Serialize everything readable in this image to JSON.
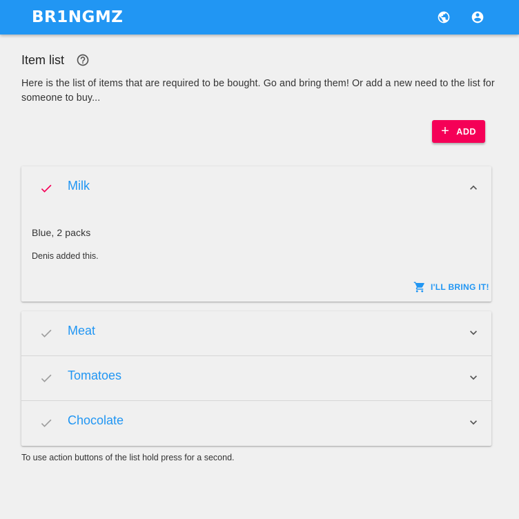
{
  "app": {
    "logo_text": "BR1NGMZ",
    "bar_color": "#2196f3",
    "icons": [
      "globe-icon",
      "account-circle-icon"
    ]
  },
  "page": {
    "title": "Item list",
    "intro": "Here is the list of items that are required to be bought. Go and bring them! Or add a new need to the list for someone to buy...",
    "add_label": "ADD",
    "footnote": "To use action buttons of the list hold press for a second."
  },
  "expanded_item": {
    "name": "Milk",
    "description": "Blue, 2 packs",
    "added_by": "Denis added this.",
    "action_label": "I'LL BRING IT!",
    "checked": true
  },
  "items": [
    {
      "name": "Meat",
      "checked": false
    },
    {
      "name": "Tomatoes",
      "checked": false
    },
    {
      "name": "Chocolate",
      "checked": false
    }
  ],
  "colors": {
    "accent": "#f50057",
    "primary": "#2196f3",
    "muted_icon": "#9e9e9e"
  }
}
